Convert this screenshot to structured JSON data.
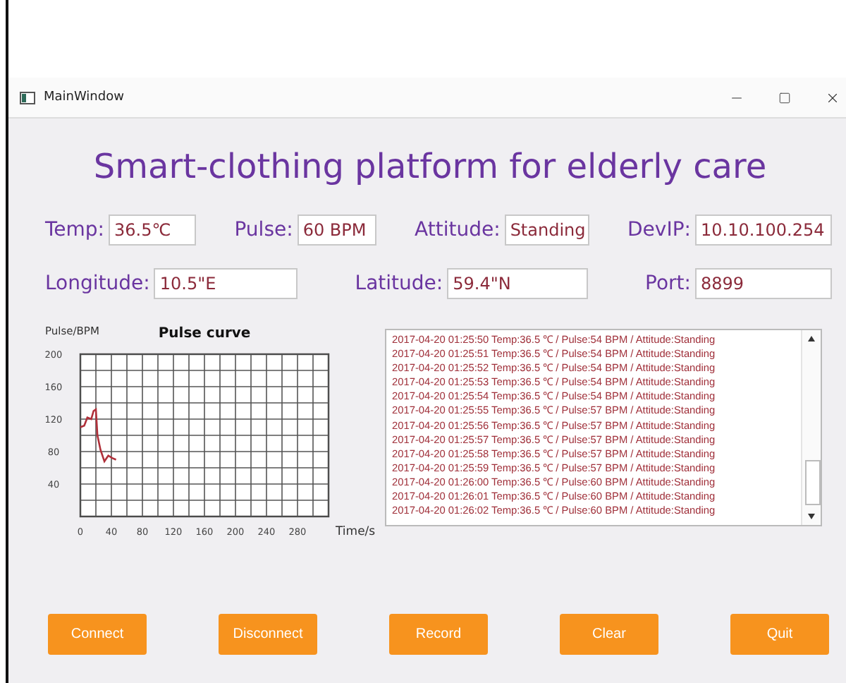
{
  "window": {
    "title": "MainWindow"
  },
  "heading": "Smart-clothing platform for elderly care",
  "fields_row_1": [
    {
      "label": "Temp:",
      "value": "36.5℃"
    },
    {
      "label": "Pulse:",
      "value": "60 BPM"
    },
    {
      "label": "Attitude:",
      "value": "Standing"
    },
    {
      "label": "DevIP:",
      "value": "10.10.100.254"
    }
  ],
  "fields_row_2": [
    {
      "label": "Longitude:",
      "value": "10.5\"E"
    },
    {
      "label": "Latitude:",
      "value": "59.4\"N"
    },
    {
      "label": "Port:",
      "value": "8899"
    }
  ],
  "chart": {
    "chart_data": {
      "type": "line",
      "title": "Pulse curve",
      "xlabel": "Time/s",
      "ylabel": "Pulse/BPM",
      "x": [
        0,
        5,
        9,
        14,
        17,
        20,
        22,
        26,
        31,
        36,
        41,
        46
      ],
      "grid": true,
      "series": [
        {
          "color": "#b0303a",
          "values": [
            110,
            112,
            122,
            120,
            130,
            132,
            100,
            82,
            68,
            75,
            72,
            70
          ]
        }
      ],
      "xlim": [
        0,
        320
      ],
      "ylim": [
        0,
        200
      ],
      "xticks": [
        0,
        40,
        80,
        120,
        160,
        200,
        240,
        280
      ],
      "yticks": [
        40,
        80,
        120,
        160,
        200
      ]
    }
  },
  "log": [
    "2017-04-20 01:25:50 Temp:36.5 ℃ / Pulse:54 BPM / Attitude:Standing",
    "2017-04-20 01:25:51 Temp:36.5 ℃ / Pulse:54 BPM / Attitude:Standing",
    "2017-04-20 01:25:52 Temp:36.5 ℃ / Pulse:54 BPM / Attitude:Standing",
    "2017-04-20 01:25:53 Temp:36.5 ℃ / Pulse:54 BPM / Attitude:Standing",
    "2017-04-20 01:25:54 Temp:36.5 ℃ / Pulse:54 BPM / Attitude:Standing",
    "2017-04-20 01:25:55 Temp:36.5 ℃ / Pulse:57 BPM / Attitude:Standing",
    "2017-04-20 01:25:56 Temp:36.5 ℃ / Pulse:57 BPM / Attitude:Standing",
    "2017-04-20 01:25:57 Temp:36.5 ℃ / Pulse:57 BPM / Attitude:Standing",
    "2017-04-20 01:25:58 Temp:36.5 ℃ / Pulse:57 BPM / Attitude:Standing",
    "2017-04-20 01:25:59 Temp:36.5 ℃ / Pulse:57 BPM / Attitude:Standing",
    "2017-04-20 01:26:00 Temp:36.5 ℃ / Pulse:60 BPM / Attitude:Standing",
    "2017-04-20 01:26:01 Temp:36.5 ℃ / Pulse:60 BPM / Attitude:Standing",
    "2017-04-20 01:26:02 Temp:36.5 ℃ / Pulse:60 BPM / Attitude:Standing"
  ],
  "buttons": [
    "Connect",
    "Disconnect",
    "Record",
    "Clear",
    "Quit"
  ]
}
